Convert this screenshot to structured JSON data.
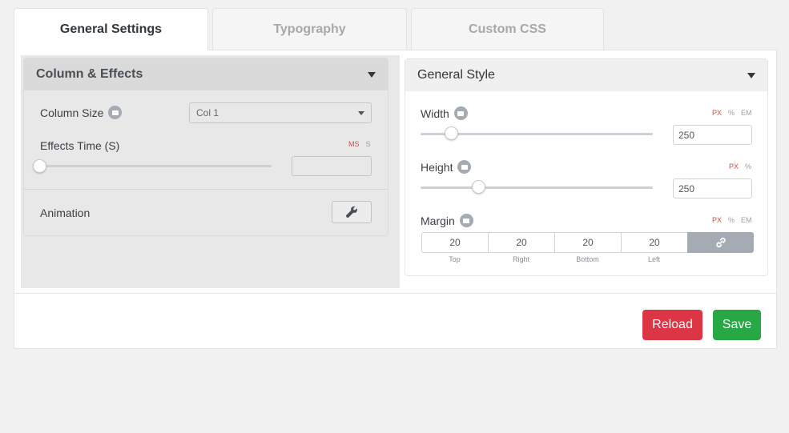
{
  "tabs": [
    {
      "label": "General Settings",
      "active": true
    },
    {
      "label": "Typography",
      "active": false
    },
    {
      "label": "Custom CSS",
      "active": false
    }
  ],
  "left_panel": {
    "title": "Column & Effects",
    "column_size": {
      "label": "Column Size",
      "value": "Col 1"
    },
    "effects_time": {
      "label": "Effects Time (S)",
      "units": [
        "MS",
        "S"
      ],
      "active_unit": "MS",
      "value": ""
    },
    "animation": {
      "label": "Animation"
    }
  },
  "right_panel": {
    "title": "General Style",
    "width": {
      "label": "Width",
      "value": "250",
      "units": [
        "PX",
        "%",
        "EM"
      ],
      "active_unit": "PX"
    },
    "height": {
      "label": "Height",
      "value": "250",
      "units": [
        "PX",
        "%"
      ],
      "active_unit": "PX"
    },
    "margin": {
      "label": "Margin",
      "units": [
        "PX",
        "%",
        "EM"
      ],
      "active_unit": "PX",
      "values": [
        "20",
        "20",
        "20",
        "20"
      ],
      "sides": [
        "Top",
        "Right",
        "Bottom",
        "Left"
      ]
    }
  },
  "buttons": {
    "reload": "Reload",
    "save": "Save"
  },
  "colors": {
    "reload": "#dc3545",
    "save": "#28a745",
    "unit_active": "#d84b4b"
  }
}
